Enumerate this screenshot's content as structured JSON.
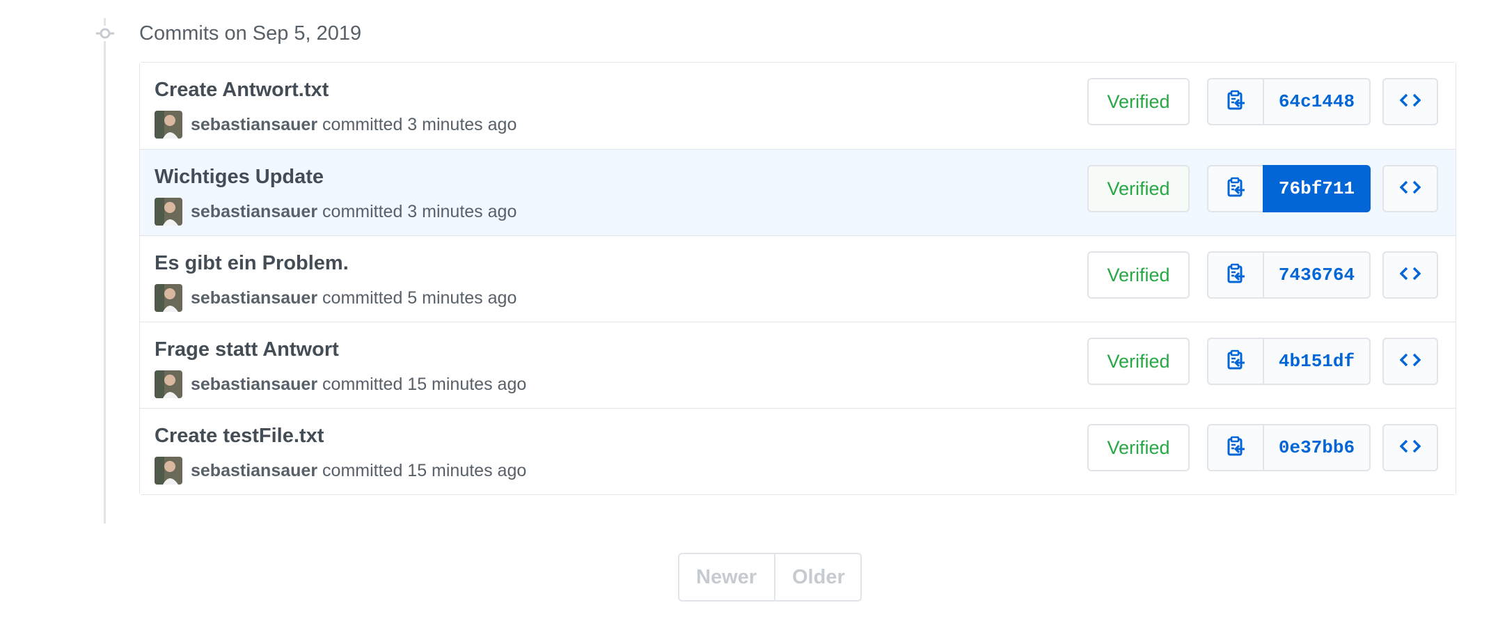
{
  "group": {
    "title": "Commits on Sep 5, 2019"
  },
  "commits": [
    {
      "title": "Create Antwort.txt",
      "author": "sebastiansauer",
      "meta": "committed 3 minutes ago",
      "verified": "Verified",
      "sha": "64c1448"
    },
    {
      "title": "Wichtiges Update",
      "author": "sebastiansauer",
      "meta": "committed 3 minutes ago",
      "verified": "Verified",
      "sha": "76bf711"
    },
    {
      "title": "Es gibt ein Problem.",
      "author": "sebastiansauer",
      "meta": "committed 5 minutes ago",
      "verified": "Verified",
      "sha": "7436764"
    },
    {
      "title": "Frage statt Antwort",
      "author": "sebastiansauer",
      "meta": "committed 15 minutes ago",
      "verified": "Verified",
      "sha": "4b151df"
    },
    {
      "title": "Create testFile.txt",
      "author": "sebastiansauer",
      "meta": "committed 15 minutes ago",
      "verified": "Verified",
      "sha": "0e37bb6"
    }
  ],
  "pagination": {
    "newer": "Newer",
    "older": "Older"
  },
  "icons": {
    "copy": "clippy-icon",
    "browse": "code-icon",
    "timeline": "git-commit-icon"
  },
  "colors": {
    "link": "#0366d6",
    "verified": "#28a745",
    "highlight": "#f1f8ff"
  }
}
